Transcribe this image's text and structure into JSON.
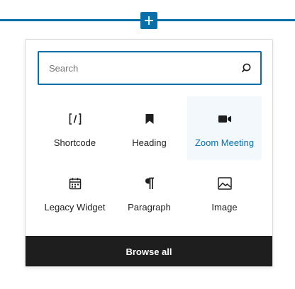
{
  "inserter": {
    "plus_icon": "plus-icon",
    "accent_color": "#0a6ea8"
  },
  "search": {
    "placeholder": "Search",
    "value": "",
    "icon": "search-icon"
  },
  "blocks": [
    {
      "label": "Shortcode",
      "icon": "shortcode-icon"
    },
    {
      "label": "Heading",
      "icon": "bookmark-icon"
    },
    {
      "label": "Zoom Meeting",
      "icon": "video-camera-icon",
      "highlighted": true
    },
    {
      "label": "Legacy Widget",
      "icon": "calendar-widget-icon"
    },
    {
      "label": "Paragraph",
      "icon": "pilcrow-icon"
    },
    {
      "label": "Image",
      "icon": "image-icon"
    }
  ],
  "browse_all": {
    "label": "Browse all"
  },
  "colors": {
    "accent": "#0a6ea8",
    "hover_bg": "#f2f8fb",
    "dark": "#1e1e1e"
  }
}
